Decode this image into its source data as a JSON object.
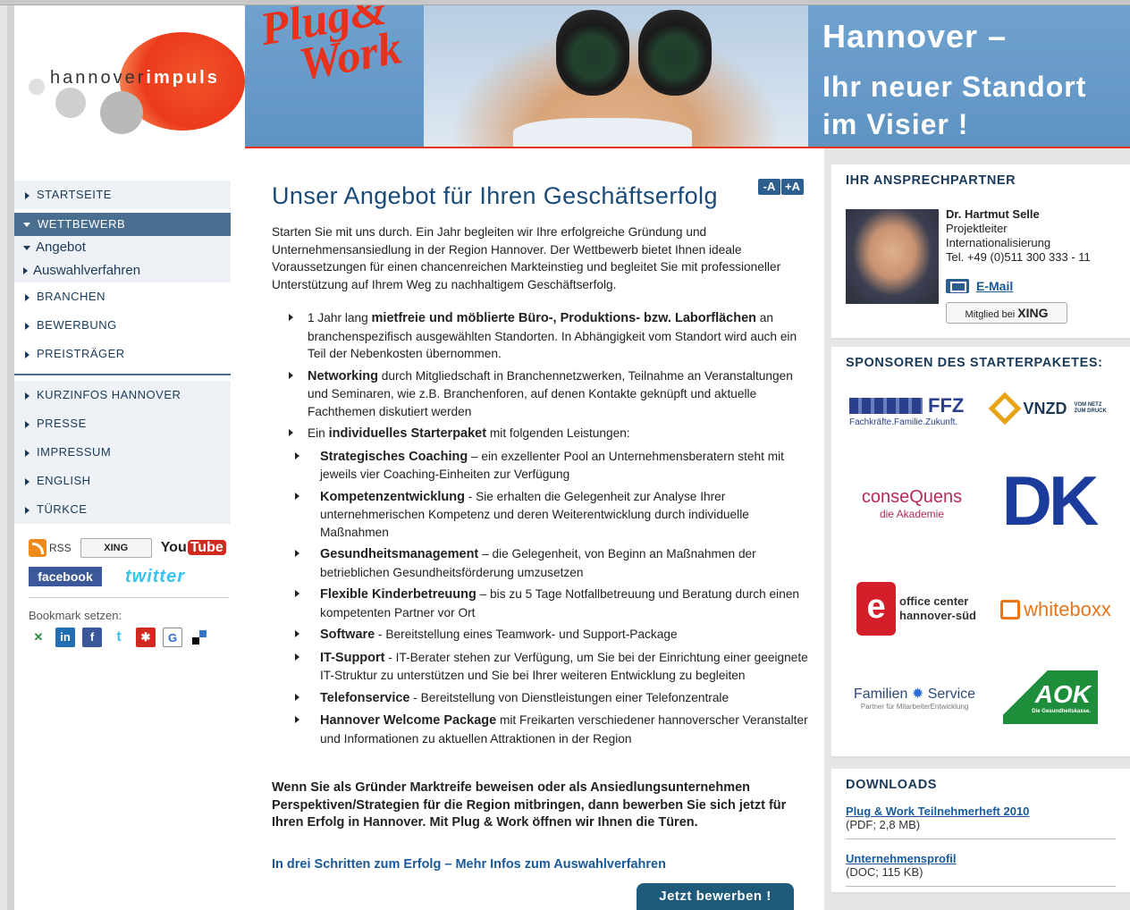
{
  "logo": {
    "text_gray": "hannover",
    "text_white": "impuls"
  },
  "header": {
    "logo_line1": "Plug&",
    "logo_line2": "Work",
    "headline1": "Hannover –",
    "headline2": "Ihr neuer Standort",
    "headline3": "im Visier !"
  },
  "nav": {
    "group1": [
      "STARTSEITE"
    ],
    "active": "WETTBEWERB",
    "sub": [
      "Angebot",
      "Auswahlverfahren"
    ],
    "group1b": [
      "BRANCHEN",
      "BEWERBUNG",
      "PREISTRÄGER"
    ],
    "group2": [
      "KURZINFOS HANNOVER",
      "PRESSE",
      "IMPRESSUM",
      "ENGLISH",
      "TÜRKCE"
    ]
  },
  "social": {
    "rss": "RSS",
    "xing": "XING",
    "youtube_a": "You",
    "youtube_b": "Tube",
    "facebook": "facebook",
    "twitter": "twitter",
    "bookmark_label": "Bookmark setzen:"
  },
  "main": {
    "title": "Unser Angebot für Ihren Geschäftserfolg",
    "font_smaller": "-A",
    "font_larger": "+A",
    "intro": "Starten Sie mit uns durch. Ein Jahr begleiten wir Ihre erfolgreiche Gründung und Unternehmensansiedlung in der Region Hannover. Der Wettbewerb bietet Ihnen ideale Voraussetzungen für einen chancenreichen Markteinstieg und begleitet Sie  mit professioneller Unterstützung auf Ihrem Weg zu nachhaltigem Geschäftserfolg.",
    "bullets": [
      {
        "pre": "1 Jahr lang ",
        "bold": "mietfreie und möblierte Büro-, Produktions- bzw. Laborflächen",
        "post": " an branchenspezifisch ausgewählten Standorten. In Abhängigkeit vom Standort wird auch ein Teil der Nebenkosten übernommen."
      },
      {
        "pre": "",
        "bold": "Networking",
        "post": " durch Mitgliedschaft in Branchennetzwerken, Teilnahme an Veranstaltungen und Seminaren, wie z.B. Branchenforen, auf denen Kontakte geknüpft und aktuelle Fachthemen diskutiert werden"
      },
      {
        "pre": "Ein ",
        "bold": "individuelles Starterpaket",
        "post": " mit folgenden Leistungen:"
      }
    ],
    "sub_bullets": [
      {
        "bold": "Strategisches Coaching",
        "post": " – ein exzellenter Pool an Unternehmensberatern steht mit jeweils vier Coaching-Einheiten zur Verfügung"
      },
      {
        "bold": "Kompetenzentwicklung",
        "post": " - Sie erhalten die Gelegenheit zur Analyse Ihrer unternehmerischen Kompetenz und deren Weiterentwicklung durch individuelle Maßnahmen"
      },
      {
        "bold": "Gesundheitsmanagement",
        "post": " – die Gelegenheit, von Beginn an Maßnahmen der betrieblichen Gesundheitsförderung umzusetzen"
      },
      {
        "bold": "Flexible Kinderbetreuung",
        "post": " – bis zu 5 Tage Notfallbetreuung und Beratung durch einen kompetenten Partner vor Ort"
      },
      {
        "bold": "Software",
        "post": " - Bereitstellung eines Teamwork- und Support-Package"
      },
      {
        "bold": "IT-Support",
        "post": " - IT-Berater stehen zur Verfügung, um Sie bei der Einrichtung einer geeignete IT-Struktur zu unterstützen und Sie bei Ihrer weiteren Entwicklung zu begleiten"
      },
      {
        "bold": "Telefonservice",
        "post": " - Bereitstellung von Dienstleistungen einer Telefonzentrale"
      },
      {
        "bold": "Hannover Welcome Package",
        "post": " mit Freikarten verschiedener hannoverscher Veranstalter und Informationen zu aktuellen Attraktionen in der Region"
      }
    ],
    "closing": "Wenn Sie als Gründer Marktreife beweisen oder als Ansiedlungsunternehmen Perspektiven/Strategien für die Region mitbringen, dann bewerben Sie sich jetzt für Ihren Erfolg in Hannover. Mit Plug & Work öffnen wir Ihnen die Türen.",
    "more_link": "In drei Schritten zum Erfolg – Mehr Infos zum Auswahlverfahren",
    "apply_button": "Jetzt bewerben !"
  },
  "contact": {
    "heading": "IHR ANSPRECHPARTNER",
    "name": "Dr. Hartmut Selle",
    "role": "Projektleiter",
    "dept": "Internationalisierung",
    "phone": "Tel. +49 (0)511 300 333 - 11",
    "email_label": "E-Mail",
    "xing_badge_pre": "Mitglied bei",
    "xing_badge_brand": "XING"
  },
  "sponsors": {
    "heading": "SPONSOREN DES STARTERPAKETES:",
    "ffz": "FFZ",
    "ffz_sub": "Fachkräfte.Familie.Zukunft.",
    "vnzd": "VNZD",
    "vnzd_sub": "VOM NETZ ZUM DRUCK",
    "consequens": "conseQuens",
    "consequens_sub": "die Akademie",
    "dk": "DK",
    "office_a": "office center",
    "office_b": "hannover-süd",
    "whiteboxx": "whiteboxx",
    "familien": "Familien",
    "familien_b": "Service",
    "familien_sub": "Partner für MitarbeiterEntwicklung",
    "aok": "AOK",
    "aok_sub": "Die Gesundheitskasse."
  },
  "downloads": {
    "heading": "DOWNLOADS",
    "items": [
      {
        "title": "Plug & Work Teilnehmerheft 2010",
        "meta": "(PDF; 2,8 MB)"
      },
      {
        "title": "Unternehmensprofil",
        "meta": "(DOC; 115 KB)"
      }
    ]
  }
}
